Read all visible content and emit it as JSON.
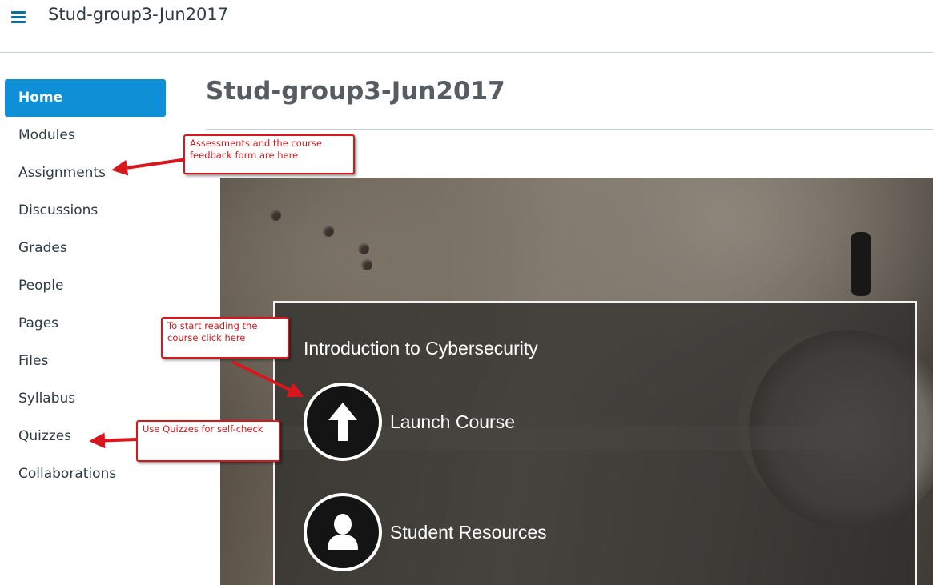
{
  "header": {
    "menu_icon": "hamburger-menu-icon",
    "breadcrumb": "Stud-group3-Jun2017"
  },
  "sidebar": {
    "items": [
      {
        "label": "Home",
        "active": true
      },
      {
        "label": "Modules"
      },
      {
        "label": "Assignments"
      },
      {
        "label": "Discussions"
      },
      {
        "label": "Grades"
      },
      {
        "label": "People"
      },
      {
        "label": "Pages"
      },
      {
        "label": "Files"
      },
      {
        "label": "Syllabus"
      },
      {
        "label": "Quizzes"
      },
      {
        "label": "Collaborations"
      }
    ]
  },
  "main": {
    "title": "Stud-group3-Jun2017",
    "banner": {
      "heading": "Introduction to Cybersecurity",
      "links": [
        {
          "label": "Launch Course",
          "icon": "up-arrow-icon"
        },
        {
          "label": "Student Resources",
          "icon": "person-icon"
        }
      ]
    }
  },
  "annotations": {
    "assignments_note": "Assessments and the course feedback form are here",
    "launch_note": "To start reading the course click here",
    "quizzes_note": "Use Quizzes for self-check"
  },
  "colors": {
    "brand_blue": "#0e8fd6",
    "annotation_red": "#d9161c",
    "text": "#2d3b45"
  }
}
